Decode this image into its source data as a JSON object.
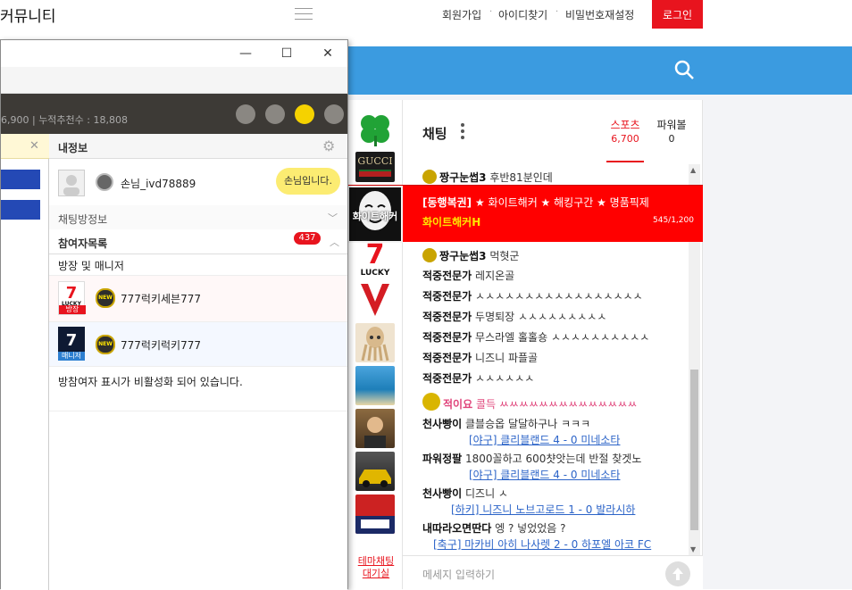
{
  "site": {
    "title": "커뮤니티",
    "links": [
      "회원가입",
      "아이디찾기",
      "비밀번호재설정"
    ],
    "login": "로그인"
  },
  "colors": {
    "accent_red": "#e8141e",
    "blue_bar": "#3b9be0",
    "gold": "#c9a400",
    "link_blue": "#2c64c8"
  },
  "sidebar": {
    "theme_link": "테마채팅 대기실"
  },
  "chat": {
    "title": "채팅",
    "tabs": [
      {
        "label": "스포츠",
        "count": "6,700"
      },
      {
        "label": "파워볼",
        "count": "0"
      }
    ],
    "banner": {
      "tag": "[동행복권]",
      "line1": "★ 화이트해커 ★ 해킹구간 ★ 명품픽제",
      "line2": "화이트해커H",
      "count": "545/1,200",
      "image_text": "화이트해커"
    },
    "messages": [
      {
        "user": "짱구눈썹3",
        "text": "후반81분인데"
      },
      {
        "user": "짱구눈썹3",
        "text": "먹혓군"
      },
      {
        "user": "적중전문가",
        "text": "레지온골"
      },
      {
        "user": "적중전문가",
        "text": "ㅅㅅㅅㅅㅅㅅㅅㅅㅅㅅㅅㅅㅅㅅㅅㅅㅅ"
      },
      {
        "user": "적중전문가",
        "text": "두명퇴장 ㅅㅅㅅㅅㅅㅅㅅㅅㅅ"
      },
      {
        "user": "적중전문가",
        "text": "무스라엘 홀홀숑 ㅅㅅㅅㅅㅅㅅㅅㅅㅅㅅ"
      },
      {
        "user": "적중전문가",
        "text": "니즈니 파플골"
      },
      {
        "user": "적중전문가",
        "text": "ㅅㅅㅅㅅㅅㅅ"
      },
      {
        "user": "적이요",
        "text": "콜득 ㅆㅆㅆㅆㅆㅆㅆㅆㅆㅆㅆㅆㅆㅆ"
      },
      {
        "user": "천사빵이",
        "text": "클블승옵 달달하구나 ㅋㅋㅋ",
        "link": "[야구] 클리블랜드 4 - 0 미네소타"
      },
      {
        "user": "파워정팔",
        "text": "1800꼴하고 600챳앗는데 반절 찾겟노",
        "link": "[야구] 클리블랜드 4 - 0 미네소타"
      },
      {
        "user": "천사빵이",
        "text": "디즈니 ㅅ",
        "link": "[하키] 니즈니 노브고로드 1 - 0 발라시하"
      },
      {
        "user": "내따라오면딴다",
        "text": "엥 ? 넣었었음 ?",
        "link": "[축구] 마카비 아히 나사렛 2 - 0 하포엘 아코 FC"
      }
    ],
    "input_placeholder": "메세지 입력하기"
  },
  "window": {
    "stats_text": "6,900  |  누적추천수 : 18,808",
    "my_info": "내정보",
    "guest_name": "손님_ivd78889",
    "guest_bubble": "손님입니다.",
    "room_info": "채팅방정보",
    "participants": "참여자목록",
    "participants_count": "437",
    "owner_section": "방장 및 매니저",
    "users": [
      {
        "name": "777럭키세븐777",
        "role": "방장",
        "logo": "LUCKY",
        "badge": "NEW"
      },
      {
        "name": "777럭키럭키777",
        "role": "매니저",
        "logo": "7",
        "badge": "NEW"
      }
    ],
    "disabled_note": "방참여자 표시가 비활성화 되어 있습니다."
  }
}
